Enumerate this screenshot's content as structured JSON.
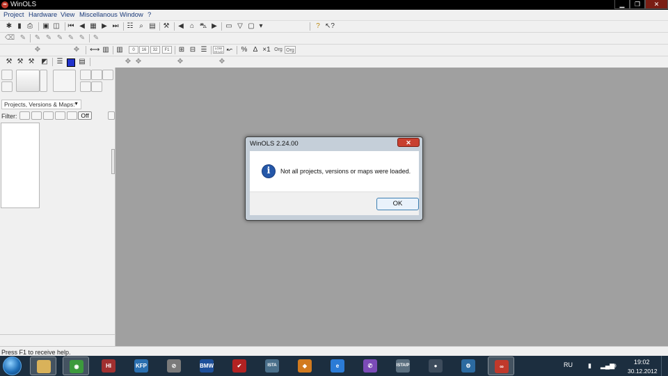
{
  "window": {
    "title": "WinOLS",
    "app_icon_glyph": "∞",
    "controls": {
      "minimize": "▁",
      "maximize": "❐",
      "close": "✕"
    }
  },
  "menubar": {
    "items": [
      "Project",
      "Hardware",
      "View",
      "Miscellanous",
      "Window",
      "?"
    ]
  },
  "toolbar": {
    "tiny_labels": [
      "0",
      "16",
      "32",
      "F1",
      "LOW HI LO",
      "Org",
      "Org"
    ]
  },
  "left_panel": {
    "combo_value": "Projects, Versions & Maps:",
    "filter_label": "Filter:",
    "off_button": "Off"
  },
  "statusbar": {
    "text": "Press F1 to receive help."
  },
  "dialog": {
    "title": "WinOLS 2.24.00",
    "message": "Not all projects, versions or maps were loaded.",
    "ok_label": "OK",
    "info_glyph": "i",
    "close_glyph": "✕"
  },
  "taskbar": {
    "apps": [
      {
        "name": "explorer-app",
        "color": "#d9b25a",
        "label": ""
      },
      {
        "name": "chrome-app",
        "color": "#3c9a3c",
        "label": "◉"
      },
      {
        "name": "app-3",
        "color": "#a03030",
        "label": "HI"
      },
      {
        "name": "kfp-app",
        "color": "#2a6fb0",
        "label": "KFP"
      },
      {
        "name": "app-5",
        "color": "#7a7a7a",
        "label": "⊘"
      },
      {
        "name": "bmw-app",
        "color": "#1d4f9a",
        "label": "BMW"
      },
      {
        "name": "app-7",
        "color": "#b22222",
        "label": "✔"
      },
      {
        "name": "ista-app",
        "color": "#4a6f8a",
        "label": "ISTA"
      },
      {
        "name": "app-9",
        "color": "#d27a1e",
        "label": "◆"
      },
      {
        "name": "ie-app",
        "color": "#2b7bd6",
        "label": "e"
      },
      {
        "name": "viber-app",
        "color": "#7b4bb7",
        "label": "✆"
      },
      {
        "name": "istap-app",
        "color": "#5a6e7e",
        "label": "ISTA/P"
      },
      {
        "name": "app-13",
        "color": "#3d4c5c",
        "label": "●"
      },
      {
        "name": "app-14",
        "color": "#2c6aa0",
        "label": "⚙"
      },
      {
        "name": "winols-app",
        "color": "#c0392b",
        "label": "∞"
      }
    ],
    "lang": "RU",
    "time": "19:02",
    "date": "30.12.2012"
  },
  "colors": {
    "workspace": "#a0a0a0",
    "dialog_frame": "#c5cfd9",
    "info_icon": "#2457a8",
    "ok_border": "#3c7fb1",
    "taskbar": "#1c2e3f"
  }
}
